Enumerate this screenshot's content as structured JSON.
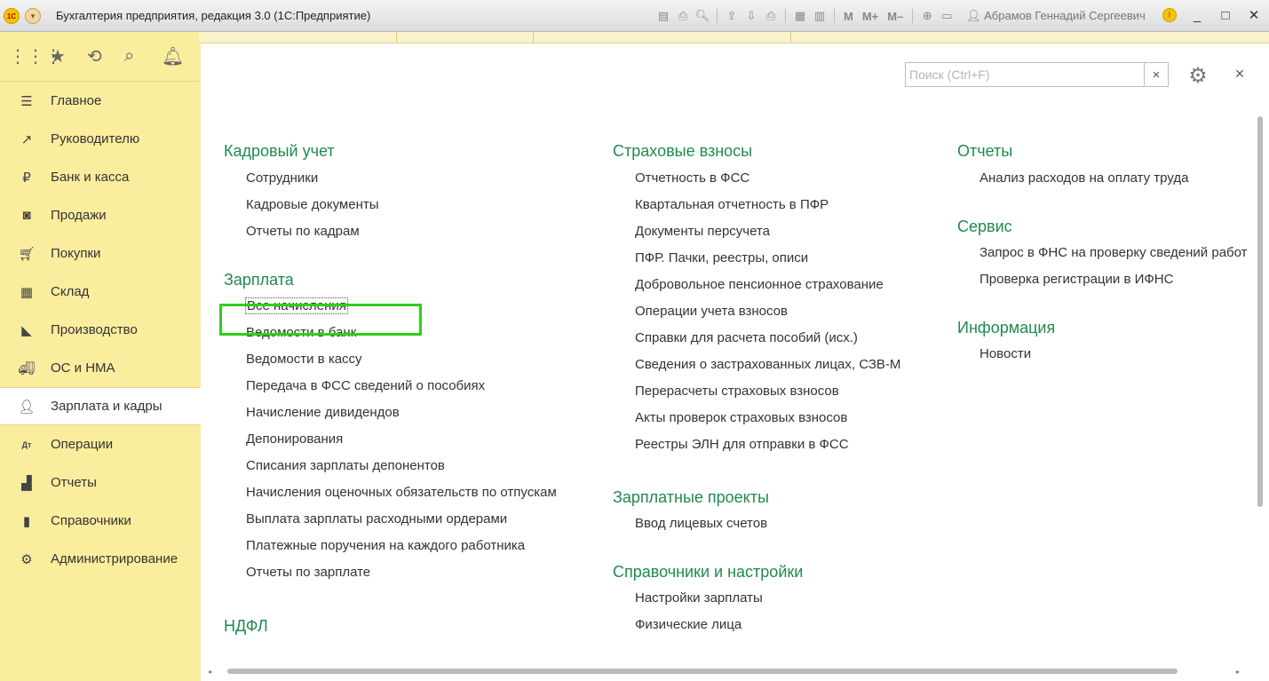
{
  "window": {
    "logo": "1С",
    "title": "Бухгалтерия предприятия, редакция 3.0  (1С:Предприятие)",
    "toolbar": [
      "M",
      "M+",
      "M–"
    ],
    "user": "Абрамов Геннадий Сергеевич",
    "info": "i",
    "minimize": "_",
    "maximize": "□",
    "close": "✕"
  },
  "sidebar": {
    "items": [
      {
        "label": "Главное",
        "icon": "menu-lines-icon"
      },
      {
        "label": "Руководителю",
        "icon": "trend-icon"
      },
      {
        "label": "Банк и касса",
        "icon": "ruble-coin-icon"
      },
      {
        "label": "Продажи",
        "icon": "shopping-bag-icon"
      },
      {
        "label": "Покупки",
        "icon": "cart-icon"
      },
      {
        "label": "Склад",
        "icon": "warehouse-icon"
      },
      {
        "label": "Производство",
        "icon": "factory-icon"
      },
      {
        "label": "ОС и НМА",
        "icon": "truck-icon"
      },
      {
        "label": "Зарплата и кадры",
        "icon": "person-icon",
        "active": true
      },
      {
        "label": "Операции",
        "icon": "debit-credit-icon"
      },
      {
        "label": "Отчеты",
        "icon": "bar-chart-icon"
      },
      {
        "label": "Справочники",
        "icon": "books-icon"
      },
      {
        "label": "Администрирование",
        "icon": "gear-icon"
      }
    ]
  },
  "search": {
    "placeholder": "Поиск (Ctrl+F)",
    "clear": "×"
  },
  "panel": {
    "close": "×"
  },
  "columns": {
    "col1": {
      "sections": [
        {
          "title": "Кадровый учет",
          "links": [
            "Сотрудники",
            "Кадровые документы",
            "Отчеты по кадрам"
          ]
        },
        {
          "title": "Зарплата",
          "links": [
            "Все начисления",
            "Ведомости в банк",
            "Ведомости в кассу",
            "Передача в ФСС сведений о пособиях",
            "Начисление дивидендов",
            "Депонирования",
            "Списания зарплаты депонентов",
            "Начисления оценочных обязательств по отпускам",
            "Выплата зарплаты расходными ордерами",
            "Платежные поручения на каждого работника",
            "Отчеты по зарплате"
          ]
        },
        {
          "title": "НДФЛ",
          "links": []
        }
      ]
    },
    "col2": {
      "sections": [
        {
          "title": "Страховые взносы",
          "links": [
            "Отчетность в ФСС",
            "Квартальная отчетность в ПФР",
            "Документы персучета",
            "ПФР. Пачки, реестры, описи",
            "Добровольное пенсионное страхование",
            "Операции учета взносов",
            "Справки для расчета пособий (исх.)",
            "Сведения о застрахованных лицах, СЗВ-М",
            "Перерасчеты страховых взносов",
            "Акты проверок страховых взносов",
            "Реестры ЭЛН для отправки в ФСС"
          ]
        },
        {
          "title": "Зарплатные проекты",
          "links": [
            "Ввод лицевых счетов"
          ]
        },
        {
          "title": "Справочники и настройки",
          "links": [
            "Настройки зарплаты",
            "Физические лица"
          ]
        }
      ]
    },
    "col3": {
      "sections": [
        {
          "title": "Отчеты",
          "links": [
            "Анализ расходов на оплату труда"
          ]
        },
        {
          "title": "Сервис",
          "links": [
            "Запрос в ФНС на проверку сведений работ",
            "Проверка регистрации в ИФНС"
          ]
        },
        {
          "title": "Информация",
          "links": [
            "Новости"
          ]
        }
      ]
    }
  },
  "colors": {
    "accent": "#2fcf18",
    "section": "#1f8a50",
    "sidebar": "#fbed9e"
  }
}
